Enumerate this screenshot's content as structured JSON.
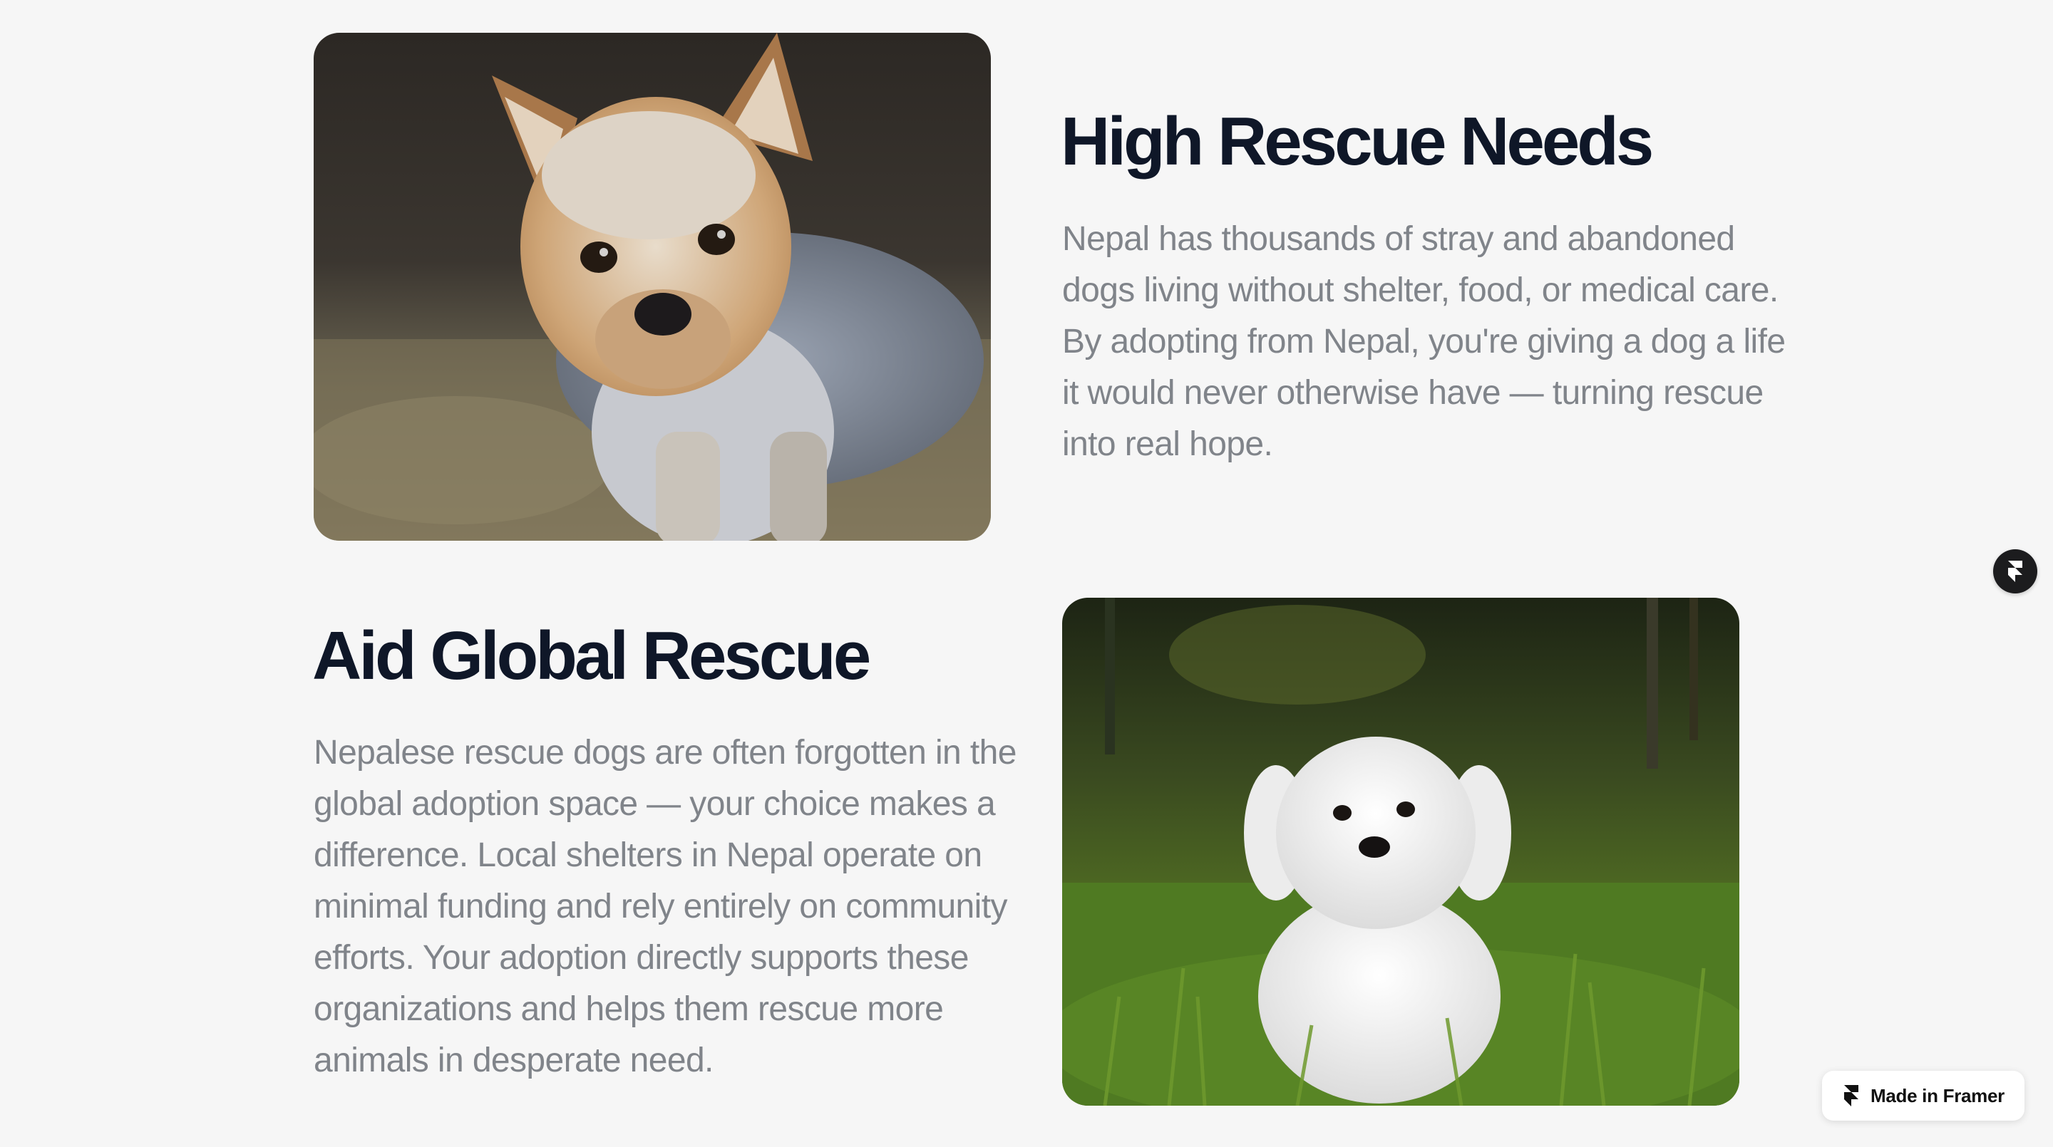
{
  "sections": [
    {
      "title": "High Rescue Needs",
      "body": "Nepal has thousands of stray and abandoned dogs living without shelter, food, or medical care. By adopting from Nepal, you're giving a dog a life it would never otherwise have — turning rescue into real hope.",
      "image": "yorkshire-terrier-photo"
    },
    {
      "title": "Aid Global Rescue",
      "body": "Nepalese rescue dogs are often forgotten in the global adoption space — your choice makes a difference. Local shelters in Nepal operate on minimal funding and rely entirely on community efforts. Your adoption directly supports these organizations and helps them rescue more animals in desperate need.",
      "image": "white-maltese-puppy-photo"
    }
  ],
  "badge": {
    "label": "Made in Framer",
    "icon": "framer-logo-icon"
  },
  "floating_button": {
    "icon": "framer-logo-icon"
  },
  "colors": {
    "background": "#f6f6f6",
    "heading": "#0f1728",
    "body": "#80848a"
  }
}
